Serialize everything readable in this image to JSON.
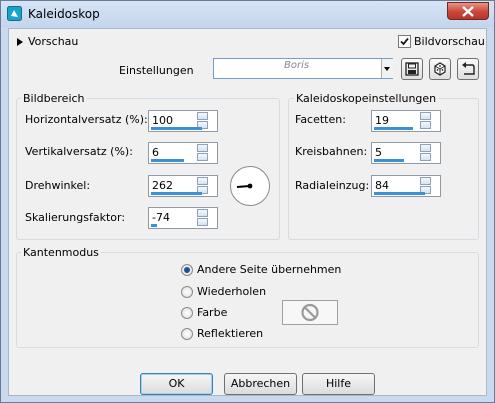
{
  "window": {
    "title": "Kaleidoskop"
  },
  "preview": {
    "toggle_label": "Vorschau",
    "checkbox_label": "Bildvorschau",
    "checked": true
  },
  "settings": {
    "label": "Einstellungen",
    "watermark": "Boris"
  },
  "bildbereich": {
    "title": "Bildbereich",
    "fields": [
      {
        "label": "Horizontalversatz (%):",
        "value": "100",
        "fill": 0.85
      },
      {
        "label": "Vertikalversatz (%):",
        "value": "6",
        "fill": 0.55
      },
      {
        "label": "Drehwinkel:",
        "value": "262",
        "fill": 0.85
      },
      {
        "label": "Skalierungsfaktor:",
        "value": "-74",
        "fill": 0.1
      }
    ]
  },
  "kaleidoskop": {
    "title": "Kaleidoskopeinstellungen",
    "fields": [
      {
        "label": "Facetten:",
        "value": "19",
        "fill": 0.65
      },
      {
        "label": "Kreisbahnen:",
        "value": "5",
        "fill": 0.5
      },
      {
        "label": "Radialeinzug:",
        "value": "84",
        "fill": 0.85
      }
    ]
  },
  "kantenmodus": {
    "title": "Kantenmodus",
    "options": [
      "Andere Seite übernehmen",
      "Wiederholen",
      "Farbe",
      "Reflektieren"
    ],
    "selected": 0
  },
  "buttons": {
    "ok": "OK",
    "cancel": "Abbrechen",
    "help": "Hilfe"
  }
}
